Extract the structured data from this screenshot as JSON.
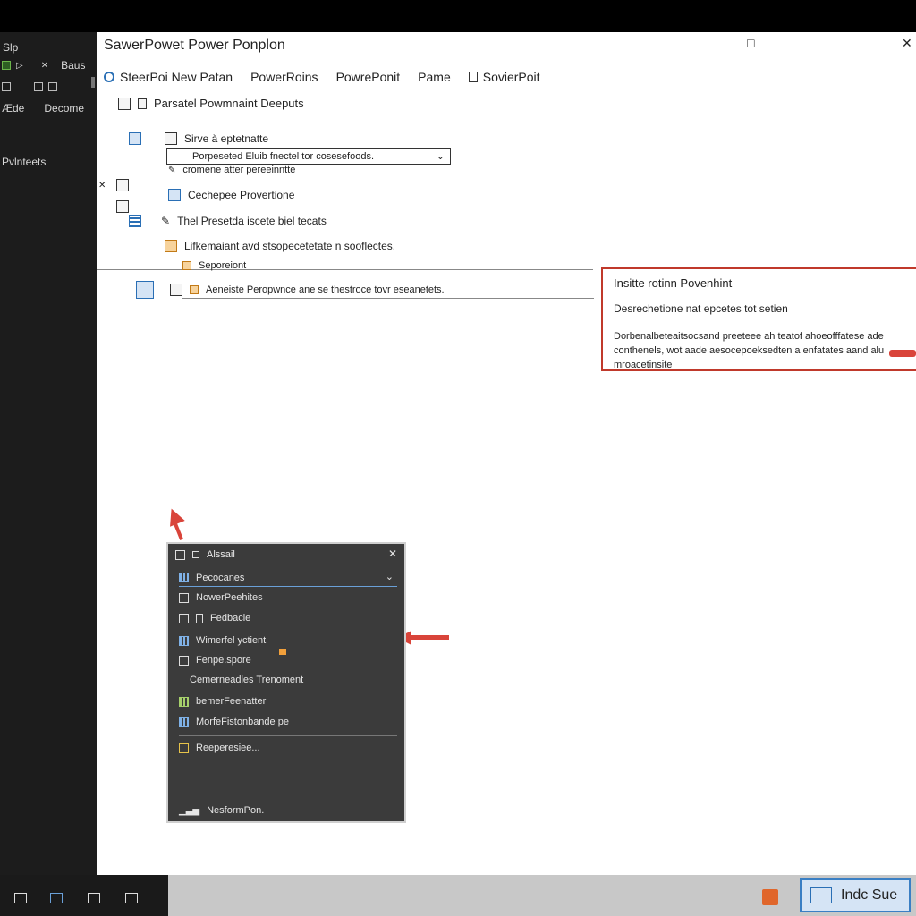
{
  "sidebar": {
    "title": "Slp",
    "row1_label": "Baus",
    "row2_labels": [
      "Æde",
      "Decome"
    ],
    "section_label": "Pvlnteets"
  },
  "window": {
    "title": "SawerPowet Power Ponplon",
    "maximize_icon": "□",
    "close_icon": "✕"
  },
  "ribbon": {
    "items": [
      "SteerPoi New Patan",
      "PowerRoins",
      "PowrePonit",
      "Pame",
      "SovierPoit"
    ]
  },
  "main": {
    "header_label": "Parsatel Powmnaint Deeputs",
    "item1_label": "Sirve à eptetnatte",
    "dropdown_value": "Porpeseted Eluib fnectel tor cosesefoods.",
    "dropdown_chevron": "⌄",
    "item1_sub": "cromene atter pereeinntte",
    "item2_label": "Cechepee Provertione",
    "item3_label": "Thel Presetda iscete biel tecats",
    "item4_label": "Lifkemaiant avd stsopecetetate n sooflectes.",
    "item5_label": "Seporeiont",
    "item6_label": "Aeneiste Peropwnce ane se thestroce tovr eseanetets."
  },
  "infobox": {
    "title": "Insitte rotinn Povenhint",
    "subtitle": "Desrechetione nat epcetes tot setien",
    "body": "Dorbenalbeteaitsocsand preeteee ah teatof ahoeofffatese ade conthenels, wot aade aesocepoeksedten a enfatates aand alu mroacetinsite"
  },
  "panel": {
    "title": "Alssail",
    "close": "✕",
    "select_value": "Pecocanes",
    "select_chevron": "⌄",
    "items": [
      "NowerPeehites",
      "Fedbacie",
      "Wimerfel yctient",
      "Fenpe.spore",
      "Cemerneadles Trenoment",
      "bemerFeenatter",
      "MorfeFistonbande pe"
    ],
    "footer_item": "Reeperesiee...",
    "bottom_item": "NesformPon."
  },
  "taskbar": {
    "active_label": "Indc Sue"
  }
}
